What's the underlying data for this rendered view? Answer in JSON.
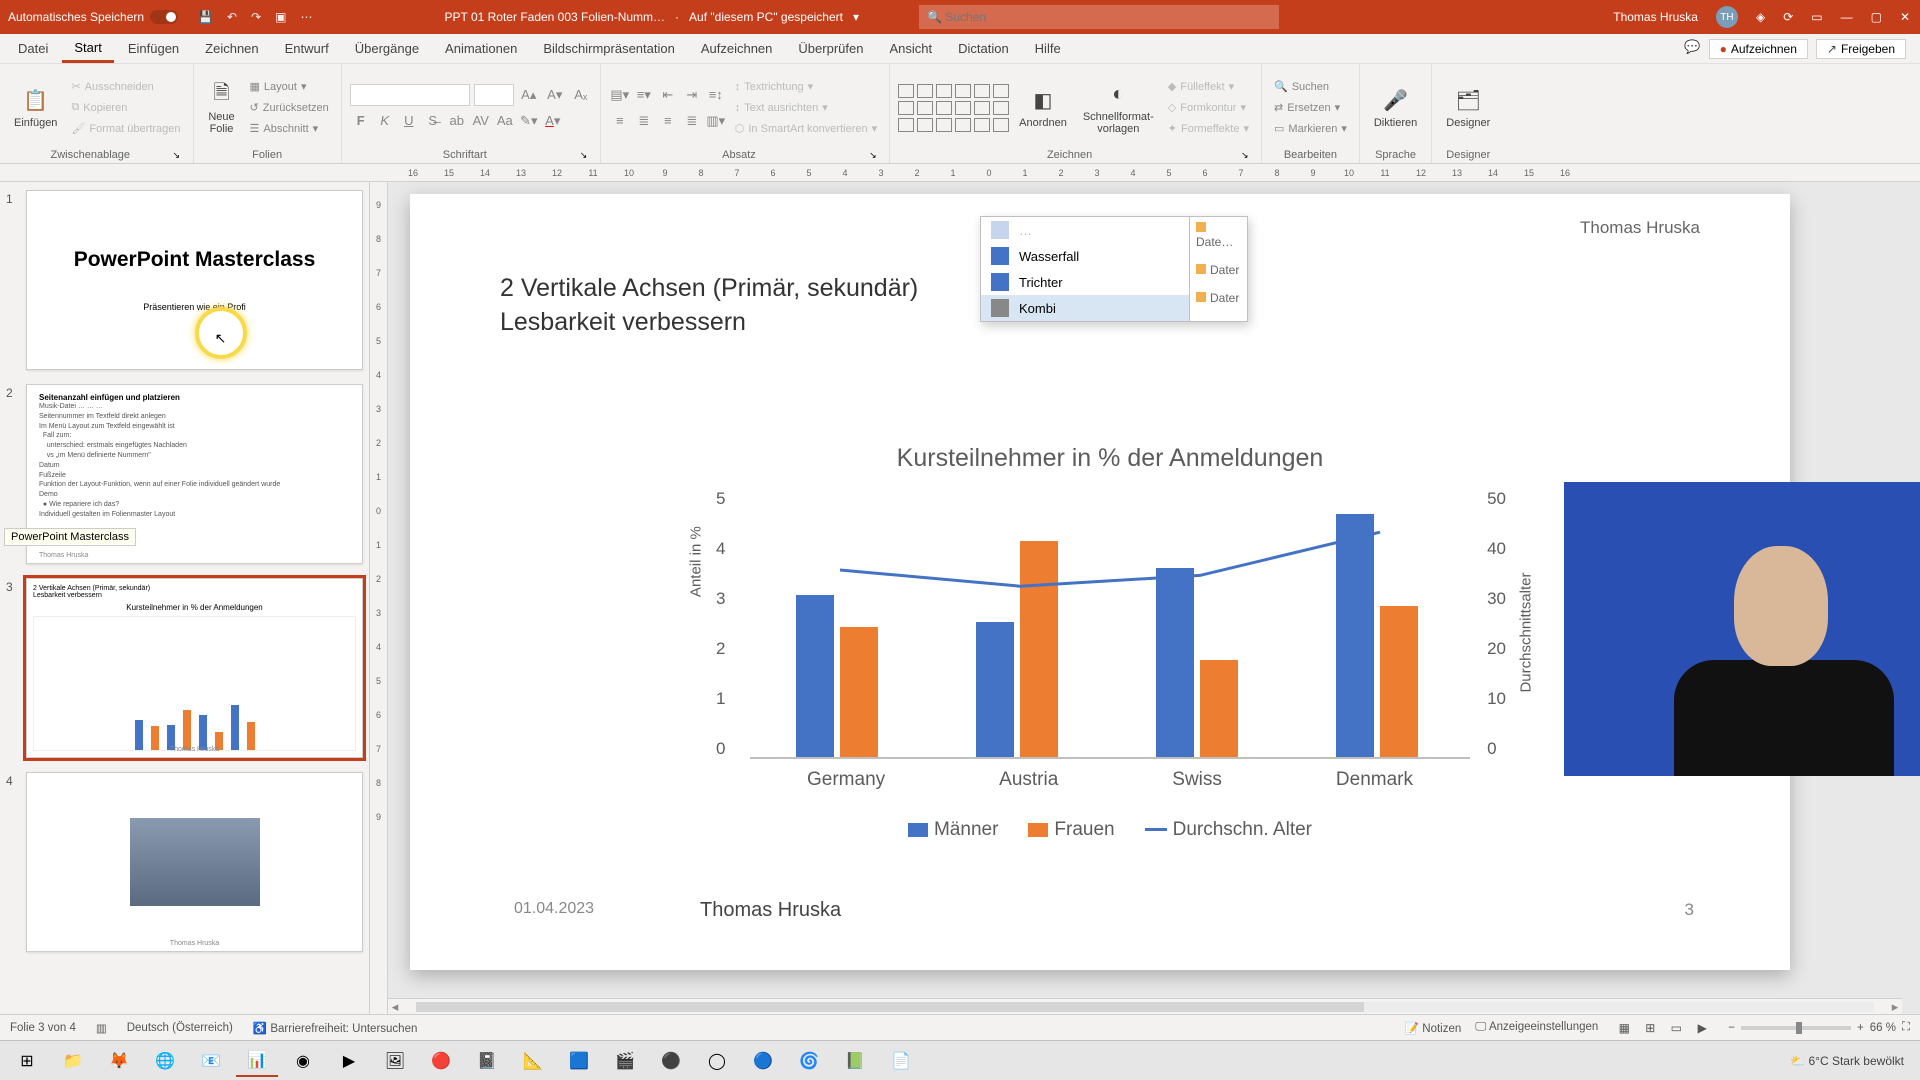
{
  "titlebar": {
    "autosave": "Automatisches Speichern",
    "filename": "PPT 01 Roter Faden 003 Folien-Numm…",
    "saved": "Auf \"diesem PC\" gespeichert",
    "search_placeholder": "Suchen",
    "user": "Thomas Hruska",
    "initials": "TH"
  },
  "tabs": {
    "items": [
      "Datei",
      "Start",
      "Einfügen",
      "Zeichnen",
      "Entwurf",
      "Übergänge",
      "Animationen",
      "Bildschirmpräsentation",
      "Aufzeichnen",
      "Überprüfen",
      "Ansicht",
      "Dictation",
      "Hilfe"
    ],
    "active_index": 1,
    "record": "Aufzeichnen",
    "share": "Freigeben"
  },
  "ribbon": {
    "paste": "Einfügen",
    "cut": "Ausschneiden",
    "copy": "Kopieren",
    "format_painter": "Format übertragen",
    "clipboard_label": "Zwischenablage",
    "new_slide": "Neue\nFolie",
    "layout": "Layout",
    "reset": "Zurücksetzen",
    "section": "Abschnitt",
    "slides_label": "Folien",
    "font_label": "Schriftart",
    "para_label": "Absatz",
    "text_dir": "Textrichtung",
    "align_text": "Text ausrichten",
    "smartart": "In SmartArt konvertieren",
    "arrange": "Anordnen",
    "quickstyles": "Schnellformat-\nvorlagen",
    "fill": "Fülleffekt",
    "outline": "Formkontur",
    "effects": "Formeffekte",
    "draw_label": "Zeichnen",
    "find": "Suchen",
    "replace": "Ersetzen",
    "select": "Markieren",
    "edit_label": "Bearbeiten",
    "dictate": "Diktieren",
    "voice_label": "Sprache",
    "designer": "Designer",
    "designer_label": "Designer"
  },
  "ruler_ticks_h": [
    "16",
    "15",
    "14",
    "13",
    "12",
    "11",
    "10",
    "9",
    "8",
    "7",
    "6",
    "5",
    "4",
    "3",
    "2",
    "1",
    "0",
    "1",
    "2",
    "3",
    "4",
    "5",
    "6",
    "7",
    "8",
    "9",
    "10",
    "11",
    "12",
    "13",
    "14",
    "15",
    "16"
  ],
  "ruler_ticks_v": [
    "9",
    "8",
    "7",
    "6",
    "5",
    "4",
    "3",
    "2",
    "1",
    "0",
    "1",
    "2",
    "3",
    "4",
    "5",
    "6",
    "7",
    "8",
    "9"
  ],
  "thumbs": {
    "tooltip": "PowerPoint Masterclass",
    "s1_title": "PowerPoint Masterclass",
    "s1_sub": "Präsentieren wie ein Profi",
    "s2_title": "Seitenanzahl einfügen und platzieren",
    "s3_author": "Thomas Hruska",
    "s3_chart_title": "Kursteilnehmer in % der Anmeldungen"
  },
  "slide": {
    "author_top": "Thomas Hruska",
    "title_line1": "2 Vertikale Achsen (Primär, sekundär)",
    "title_line2": "Lesbarkeit verbessern",
    "popup": {
      "wasserfall": "Wasserfall",
      "trichter": "Trichter",
      "kombi": "Kombi",
      "r1": "Date…",
      "r2": "Dater",
      "r3": "Dater"
    },
    "footer_date": "01.04.2023",
    "footer_author": "Thomas Hruska",
    "footer_num": "3"
  },
  "chart_data": {
    "type": "bar",
    "title": "Kursteilnehmer in % der Anmeldungen",
    "categories": [
      "Germany",
      "Austria",
      "Swiss",
      "Denmark"
    ],
    "series": [
      {
        "name": "Männer",
        "values": [
          3.0,
          2.5,
          3.5,
          4.5
        ]
      },
      {
        "name": "Frauen",
        "values": [
          2.4,
          4.0,
          1.8,
          2.8
        ]
      }
    ],
    "line_series": {
      "name": "Durchschn. Alter",
      "values": [
        35,
        32,
        34,
        42
      ]
    },
    "ylabel_left": "Anteil in %",
    "ylabel_right": "Durchschnittsalter",
    "ylim_left": [
      0,
      5
    ],
    "ylim_right": [
      0,
      50
    ],
    "yticks_left": [
      "0",
      "1",
      "2",
      "3",
      "4",
      "5"
    ],
    "yticks_right": [
      "0",
      "10",
      "20",
      "30",
      "40",
      "50"
    ],
    "legend": [
      "Männer",
      "Frauen",
      "Durchschn. Alter"
    ]
  },
  "status": {
    "slide_count": "Folie 3 von 4",
    "lang": "Deutsch (Österreich)",
    "access": "Barrierefreiheit: Untersuchen",
    "notes": "Notizen",
    "display": "Anzeigeeinstellungen",
    "zoom": "66 %"
  },
  "taskbar": {
    "weather": "6°C  Stark bewölkt"
  }
}
